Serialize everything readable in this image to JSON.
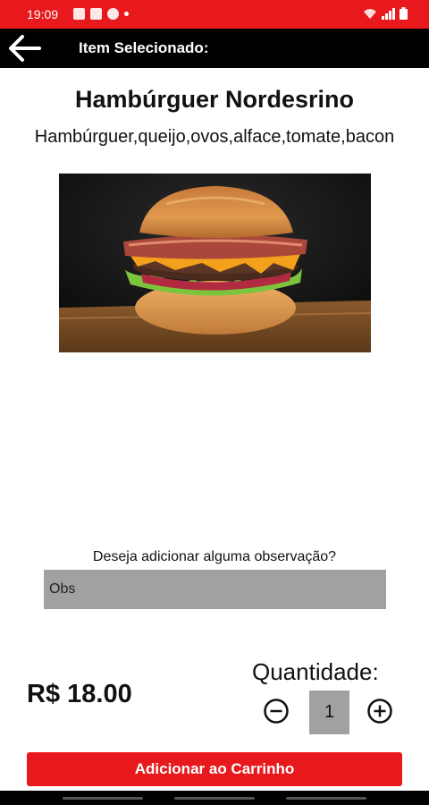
{
  "status_bar": {
    "time": "19:09"
  },
  "header": {
    "title": "Item Selecionado:"
  },
  "item": {
    "name": "Hambúrguer Nordesrino",
    "description": "Hambúrguer,queijo,ovos,alface,tomate,bacon",
    "image_icon": "burger-photo"
  },
  "observation": {
    "label": "Deseja adicionar alguma observação?",
    "placeholder": "Obs"
  },
  "price": "R$ 18.00",
  "quantity": {
    "label": "Quantidade:",
    "value": "1"
  },
  "cart_button": {
    "label": "Adicionar ao Carrinho"
  },
  "colors": {
    "accent": "#e8191c",
    "header_bg": "#000000",
    "field_bg": "#a1a1a1"
  }
}
